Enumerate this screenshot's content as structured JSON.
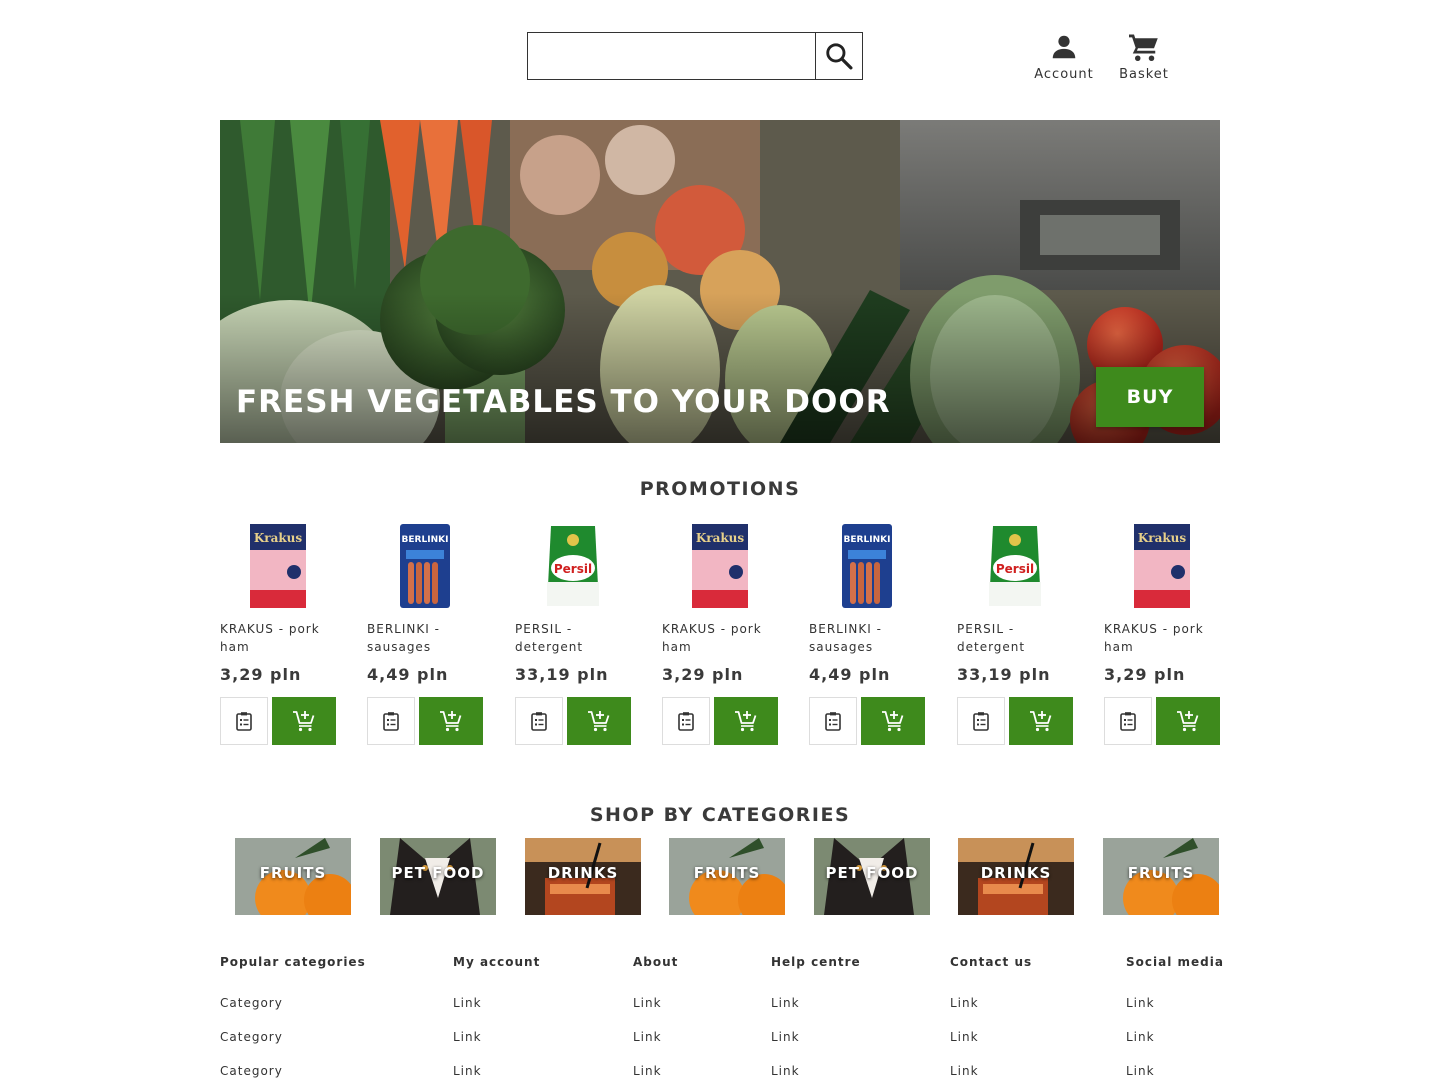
{
  "search": {
    "placeholder": "",
    "value": ""
  },
  "header": {
    "account_label": "Account",
    "basket_label": "Basket"
  },
  "hero": {
    "title": "FRESH VEGETABLES TO YOUR DOOR",
    "buy_label": "BUY"
  },
  "promotions": {
    "title": "PROMOTIONS",
    "products": [
      {
        "name": "KRAKUS - pork ham",
        "price": "3,29 pln",
        "image": "krakus-ham-pack"
      },
      {
        "name": "BERLINKI - sausages",
        "price": "4,49 pln",
        "image": "berlinki-sausages-pack"
      },
      {
        "name": "PERSIL - detergent",
        "price": "33,19 pln",
        "image": "persil-detergent-bag"
      },
      {
        "name": "KRAKUS - pork ham",
        "price": "3,29 pln",
        "image": "krakus-ham-pack"
      },
      {
        "name": "BERLINKI - sausages",
        "price": "4,49 pln",
        "image": "berlinki-sausages-pack"
      },
      {
        "name": "PERSIL - detergent",
        "price": "33,19 pln",
        "image": "persil-detergent-bag"
      },
      {
        "name": "KRAKUS - pork ham",
        "price": "3,29 pln",
        "image": "krakus-ham-pack"
      }
    ]
  },
  "categories": {
    "title": "SHOP BY CATEGORIES",
    "items": [
      {
        "label": "FRUITS",
        "image": "oranges"
      },
      {
        "label": "PET FOOD",
        "image": "dog"
      },
      {
        "label": "DRINKS",
        "image": "iced-drink"
      },
      {
        "label": "FRUITS",
        "image": "oranges"
      },
      {
        "label": "PET FOOD",
        "image": "dog"
      },
      {
        "label": "DRINKS",
        "image": "iced-drink"
      },
      {
        "label": "FRUITS",
        "image": "oranges"
      }
    ]
  },
  "footer": {
    "columns": [
      {
        "heading": "Popular categories",
        "links": [
          "Category",
          "Category",
          "Category"
        ]
      },
      {
        "heading": "My account",
        "links": [
          "Link",
          "Link",
          "Link"
        ]
      },
      {
        "heading": "About",
        "links": [
          "Link",
          "Link",
          "Link"
        ]
      },
      {
        "heading": "Help centre",
        "links": [
          "Link",
          "Link",
          "Link"
        ]
      },
      {
        "heading": "Contact us",
        "links": [
          "Link",
          "Link",
          "Link"
        ]
      },
      {
        "heading": "Social media",
        "links": [
          "Link",
          "Link",
          "Link"
        ]
      }
    ]
  },
  "colors": {
    "accent_green": "#3e8a1c",
    "text_dark": "#333333",
    "border": "#333333"
  },
  "icons": {
    "search": "search-icon",
    "account": "person-icon",
    "basket": "cart-icon",
    "list": "shopping-list-icon",
    "add_to_cart": "add-to-cart-icon"
  }
}
